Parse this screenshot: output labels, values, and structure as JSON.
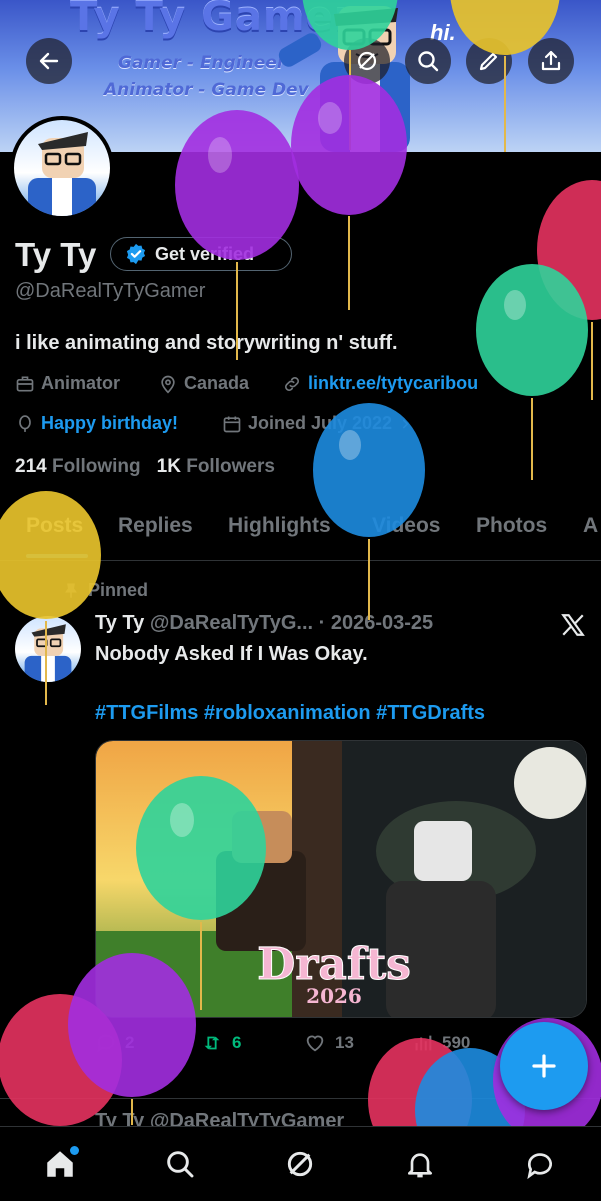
{
  "banner": {
    "title": "Ty Ty Gamer",
    "line1": "Gamer - Engineer",
    "line2": "Animator - Game Dev",
    "hi": "hi."
  },
  "header": {
    "icons": [
      "back-arrow-icon",
      "grok-icon",
      "search-icon",
      "edit-icon",
      "share-icon"
    ]
  },
  "profile": {
    "name": "Ty Ty",
    "verify_label": "Get verified",
    "handle": "@DaRealTyTyGamer",
    "bio": "i like animating and storywriting n' stuff.",
    "profession": "Animator",
    "location": "Canada",
    "link": "linktr.ee/tytycaribou",
    "birthday": "Happy birthday!",
    "joined": "Joined July 2022",
    "following_count": "214",
    "following_label": "Following",
    "followers_count": "1K",
    "followers_label": "Followers"
  },
  "tabs": [
    "Posts",
    "Replies",
    "Highlights",
    "Videos",
    "Photos",
    "A"
  ],
  "post": {
    "pinned_label": "Pinned",
    "author": "Ty Ty",
    "handle_date": "@DaRealTyTyG... · 2026-03-25",
    "text": "Nobody Asked If I Was Okay.",
    "hashtags": "#TTGFilms #robloxanimation #TTGDrafts",
    "media_title": "Drafts",
    "media_year": "2026",
    "replies": "2",
    "reposts": "6",
    "likes": "13",
    "views": "590"
  },
  "post2_header": "Ty Ty @DaRealTyTyGamer",
  "nav": [
    "home-icon",
    "search-icon",
    "grok-icon",
    "notifications-icon",
    "messages-icon"
  ],
  "colors": {
    "accent": "#1d9bf0",
    "repost_active": "#00ba7c",
    "background": "#000000",
    "muted": "#71767b"
  }
}
